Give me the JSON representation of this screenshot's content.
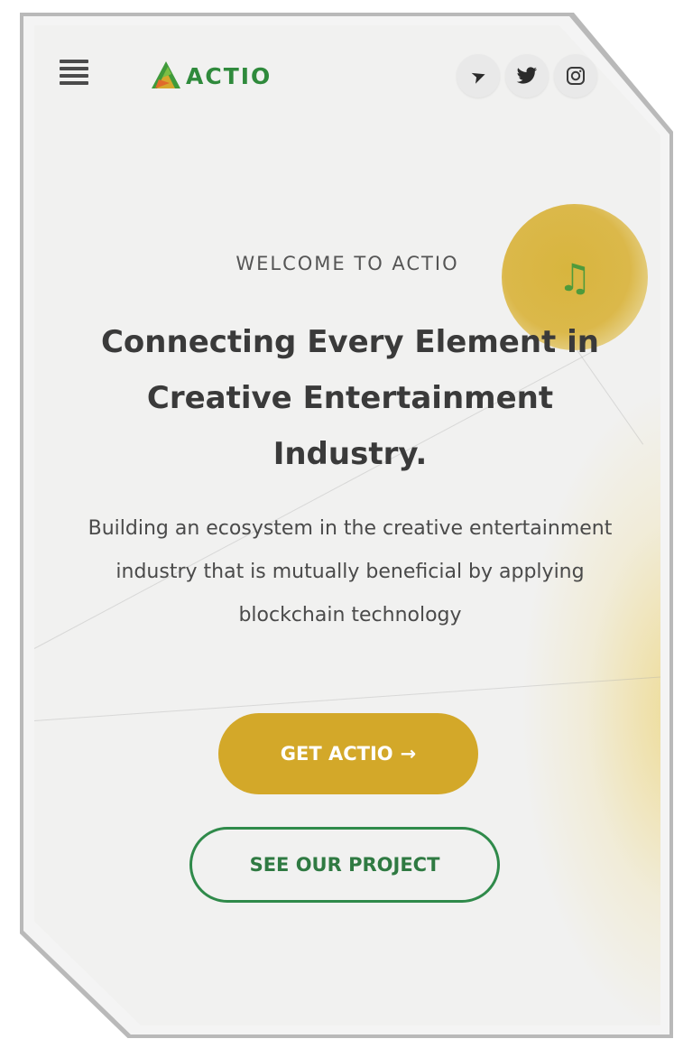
{
  "header": {
    "menu_icon": "hamburger-menu-icon",
    "logo_text": "ACTIO",
    "socials": [
      {
        "icon": "telegram-icon",
        "glyph": "➤"
      },
      {
        "icon": "twitter-icon",
        "glyph": "🐦"
      },
      {
        "icon": "instagram-icon",
        "glyph": "◎"
      }
    ]
  },
  "music": {
    "icon": "music-note-icon",
    "glyph": "♫"
  },
  "hero": {
    "eyebrow": "WELCOME TO ACTIO",
    "headline": "Connecting Every Element in Creative Entertainment Industry.",
    "subtext": "Building an ecosystem in the creative entertainment industry that is mutually beneficial by applying blockchain technology"
  },
  "actions": {
    "primary_label": "GET ACTIO",
    "primary_arrow": "→",
    "secondary_label": "SEE OUR PROJECT"
  },
  "colors": {
    "brand_green": "#2f8a3c",
    "accent_gold": "#d3a829",
    "background": "#f1f1f0"
  }
}
